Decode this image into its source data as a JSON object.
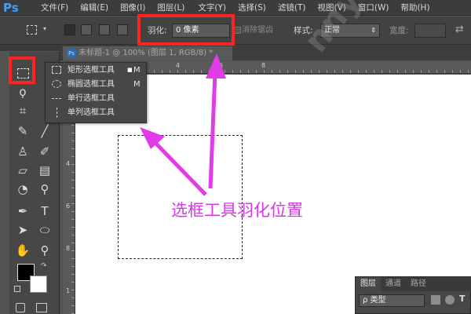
{
  "app": {
    "logo": "Ps"
  },
  "menu": [
    "文件(F)",
    "编辑(E)",
    "图像(I)",
    "图层(L)",
    "文字(Y)",
    "选择(S)",
    "滤镜(T)",
    "视图(V)",
    "窗口(W)",
    "帮助(H)"
  ],
  "options": {
    "feather_label": "羽化:",
    "feather_value": "0 像素",
    "refine_edge": "消除锯齿",
    "style_label": "样式:",
    "style_value": "正常",
    "width_label": "宽度:"
  },
  "document": {
    "tab_title": "未标题-1 @ 100% (图层 1, RGB/8) *",
    "tab_icon": "Ps"
  },
  "ruler": {
    "h": [
      "0",
      "2",
      "4",
      "6",
      "8"
    ],
    "v": [
      "2",
      "4",
      "6",
      "8",
      "1"
    ]
  },
  "flyout": {
    "items": [
      {
        "label": "矩形选框工具",
        "key": "M",
        "icon": "rect-marquee-icon"
      },
      {
        "label": "椭圆选框工具",
        "key": "M",
        "icon": "ellipse-marquee-icon"
      },
      {
        "label": "单行选框工具",
        "key": "",
        "icon": "single-row-marquee-icon"
      },
      {
        "label": "单列选框工具",
        "key": "",
        "icon": "single-column-marquee-icon"
      }
    ]
  },
  "annotation": {
    "text": "选框工具羽化位置",
    "color": "#d836e6"
  },
  "watermark": {
    "text": "nnyMelody夏"
  },
  "layers_panel": {
    "tabs": [
      "图层",
      "通道",
      "路径"
    ],
    "filter_value": "ρ 类型"
  },
  "colors": {
    "highlight": "#ff2323",
    "annotation": "#d836e6",
    "foreground": "#000000",
    "background": "#ffffff"
  }
}
